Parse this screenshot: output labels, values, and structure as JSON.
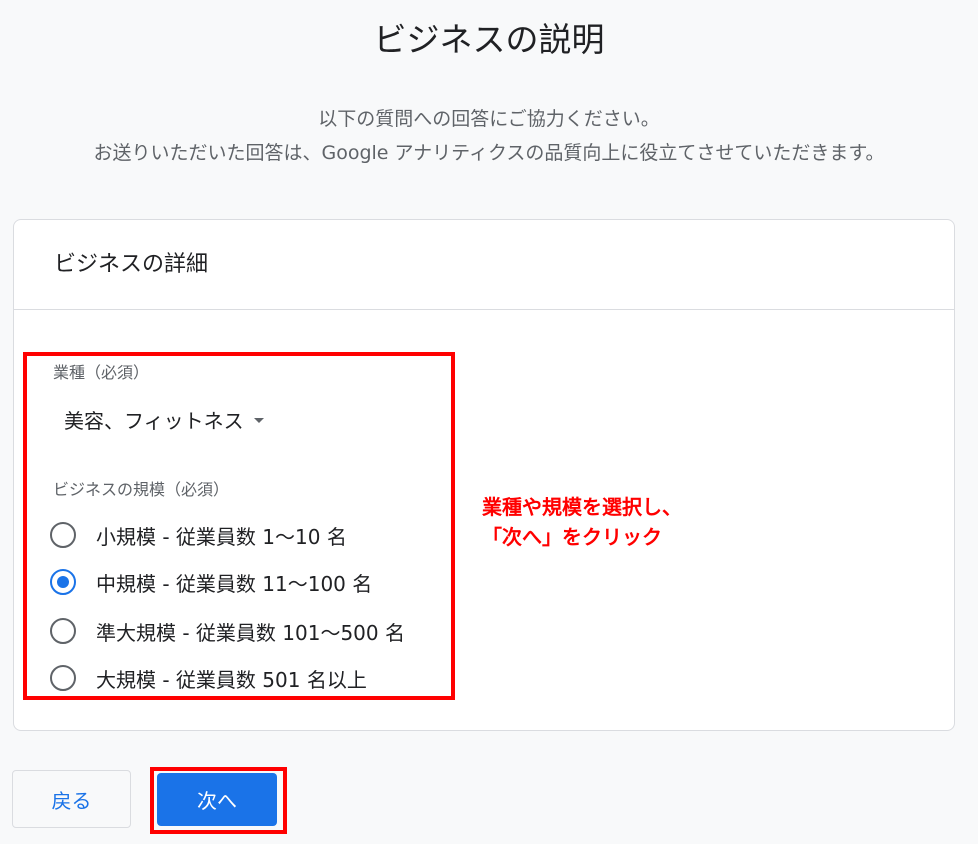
{
  "page": {
    "title": "ビジネスの説明",
    "subtitle_line1": "以下の質問への回答にご協力ください。",
    "subtitle_line2": "お送りいただいた回答は、Google アナリティクスの品質向上に役立てさせていただきます。"
  },
  "card": {
    "header": "ビジネスの詳細",
    "industry": {
      "label": "業種（必須）",
      "selected": "美容、フィットネス"
    },
    "size": {
      "label": "ビジネスの規模（必須）",
      "options": [
        {
          "label": "小規模 - 従業員数 1～10 名",
          "checked": false
        },
        {
          "label": "中規模 - 従業員数 11～100 名",
          "checked": true
        },
        {
          "label": "準大規模 - 従業員数 101～500 名",
          "checked": false
        },
        {
          "label": "大規模 - 従業員数 501 名以上",
          "checked": false
        }
      ]
    }
  },
  "annotation": {
    "line1": "業種や規模を選択し、",
    "line2": "「次へ」をクリック",
    "color": "#ff0000"
  },
  "buttons": {
    "back": "戻る",
    "next": "次へ"
  },
  "colors": {
    "accent": "#1a73e8",
    "background": "#f8f9fa"
  }
}
